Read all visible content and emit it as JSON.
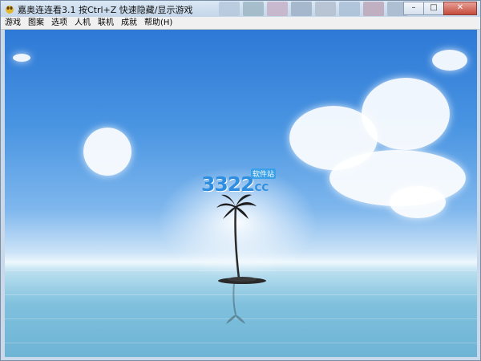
{
  "window": {
    "title": "嘉奥连连看3.1 按Ctrl+Z 快速隐藏/显示游戏",
    "controls": [
      "minimize-icon",
      "maximize-icon",
      "close-icon"
    ]
  },
  "menu": [
    "游戏",
    "图案",
    "选项",
    "人机",
    "联机",
    "成就",
    "帮助(H)"
  ],
  "logo": {
    "number": "3322",
    "domain": ".CC",
    "badge": "软件站"
  },
  "colors": {
    "sky_top": "#2d79d6",
    "sea": "#6eb4d5",
    "titlebar": "#c4d6ea"
  }
}
